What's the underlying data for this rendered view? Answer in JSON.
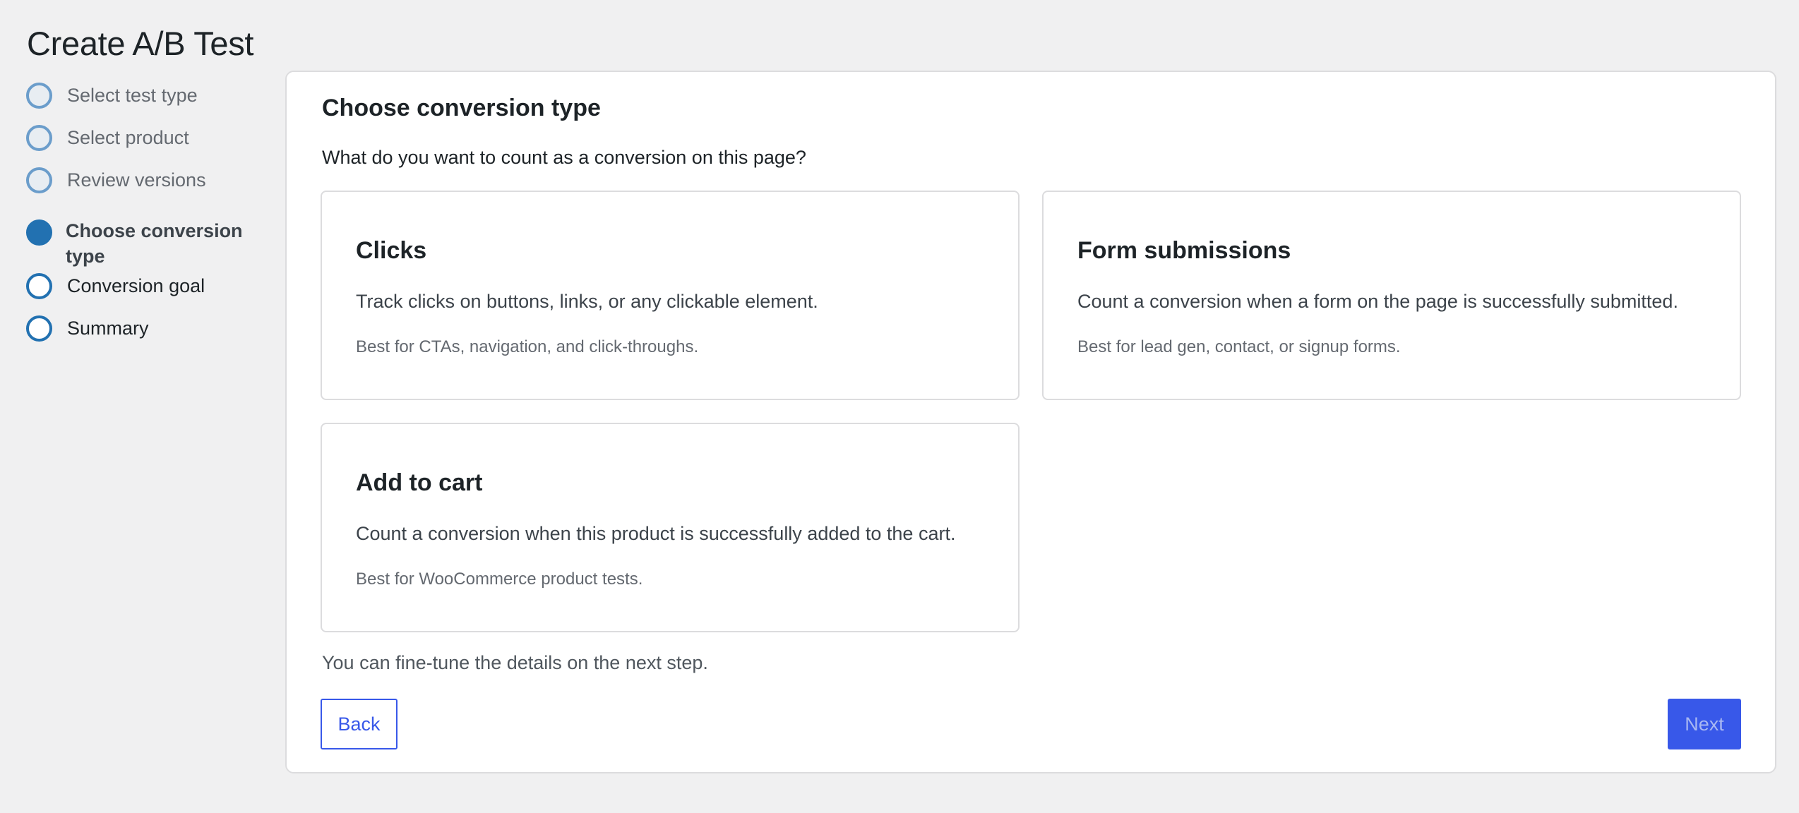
{
  "page": {
    "title": "Create A/B Test"
  },
  "stepper": {
    "steps": [
      {
        "label": "Select test type",
        "state": "done"
      },
      {
        "label": "Select product",
        "state": "done"
      },
      {
        "label": "Review versions",
        "state": "done"
      },
      {
        "label": "Choose conversion type",
        "state": "current"
      },
      {
        "label": "Conversion goal",
        "state": "upcoming"
      },
      {
        "label": "Summary",
        "state": "upcoming"
      }
    ]
  },
  "panel": {
    "title": "Choose conversion type",
    "question": "What do you want to count as a conversion on this page?",
    "cards": [
      {
        "title": "Clicks",
        "description": "Track clicks on buttons, links, or any clickable element.",
        "hint": "Best for CTAs, navigation, and click-throughs."
      },
      {
        "title": "Form submissions",
        "description": "Count a conversion when a form on the page is successfully submitted.",
        "hint": "Best for lead gen, contact, or signup forms."
      },
      {
        "title": "Add to cart",
        "description": "Count a conversion when this product is successfully added to the cart.",
        "hint": "Best for WooCommerce product tests."
      }
    ],
    "footnote": "You can fine-tune the details on the next step.",
    "back_label": "Back",
    "next_label": "Next"
  },
  "colors": {
    "accent": "#3858e9",
    "step_active": "#2271b1",
    "step_done": "#6b9dcb",
    "background": "#f0f0f1"
  }
}
